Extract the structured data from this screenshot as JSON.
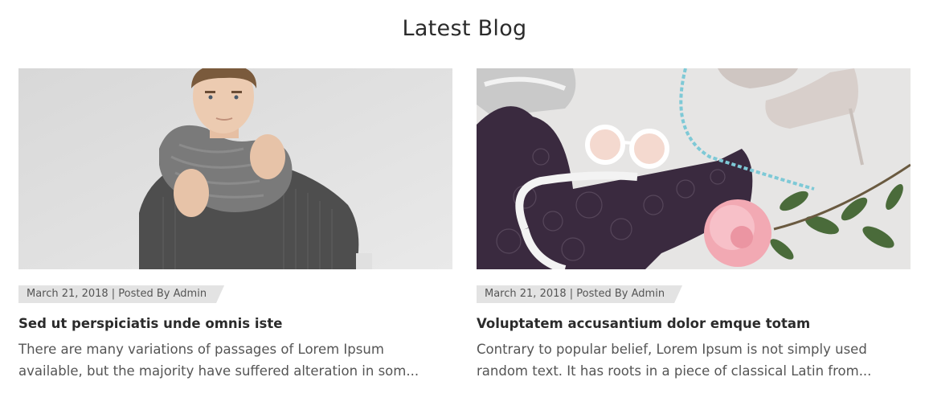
{
  "section": {
    "title": "Latest Blog"
  },
  "posts": [
    {
      "image_alt": "Man in grey knit scarf and sweater",
      "meta": "March 21, 2018 | Posted By Admin",
      "title": "Sed ut perspiciatis unde omnis iste",
      "excerpt_lines": [
        "There are many variations of passages of Lorem Ipsum",
        "available, but the majority have suffered alteration in som..."
      ]
    },
    {
      "image_alt": "Flat lay of lace top, sunglasses, heels and peony",
      "meta": "March 21, 2018 | Posted By Admin",
      "title": "Voluptatem accusantium dolor emque totam",
      "excerpt_lines": [
        "Contrary to popular belief, Lorem Ipsum is not simply used",
        "random text. It has roots in a piece of classical Latin from..."
      ]
    }
  ],
  "colors": {
    "title": "#2b2b2b",
    "text": "#555555",
    "meta_bg": "#e3e3e3"
  }
}
